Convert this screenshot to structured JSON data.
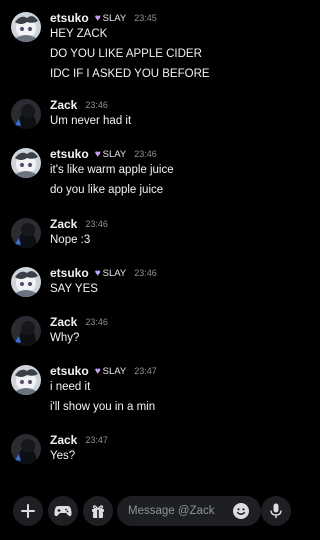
{
  "conversation": {
    "recipient": "Zack",
    "messages": [
      {
        "author": "etsuko",
        "role": "SLAY",
        "time": "23:45",
        "lines": [
          "HEY ZACK",
          "DO YOU LIKE APPLE CIDER",
          "IDC IF I ASKED YOU BEFORE"
        ]
      },
      {
        "author": "Zack",
        "role": "",
        "time": "23:46",
        "lines": [
          "Um never had it"
        ]
      },
      {
        "author": "etsuko",
        "role": "SLAY",
        "time": "23:46",
        "lines": [
          "it's like warm apple juice",
          "do you like apple juice"
        ]
      },
      {
        "author": "Zack",
        "role": "",
        "time": "23:46",
        "lines": [
          "Nope :3"
        ]
      },
      {
        "author": "etsuko",
        "role": "SLAY",
        "time": "23:46",
        "lines": [
          "SAY YES"
        ]
      },
      {
        "author": "Zack",
        "role": "",
        "time": "23:46",
        "lines": [
          "Why?"
        ]
      },
      {
        "author": "etsuko",
        "role": "SLAY",
        "time": "23:47",
        "lines": [
          "i need it",
          "i'll show you in a min"
        ]
      },
      {
        "author": "Zack",
        "role": "",
        "time": "23:47",
        "lines": [
          "Yes?"
        ]
      }
    ]
  },
  "composer": {
    "placeholder": "Message @Zack"
  },
  "icons": {
    "plus": "plus-icon",
    "games": "gamepad-icon",
    "gift": "gift-icon",
    "emoji": "emoji-icon",
    "mic": "microphone-icon"
  },
  "colors": {
    "background": "#000000",
    "role_heart": "#c8a4ff",
    "timestamp": "#8e9297"
  }
}
